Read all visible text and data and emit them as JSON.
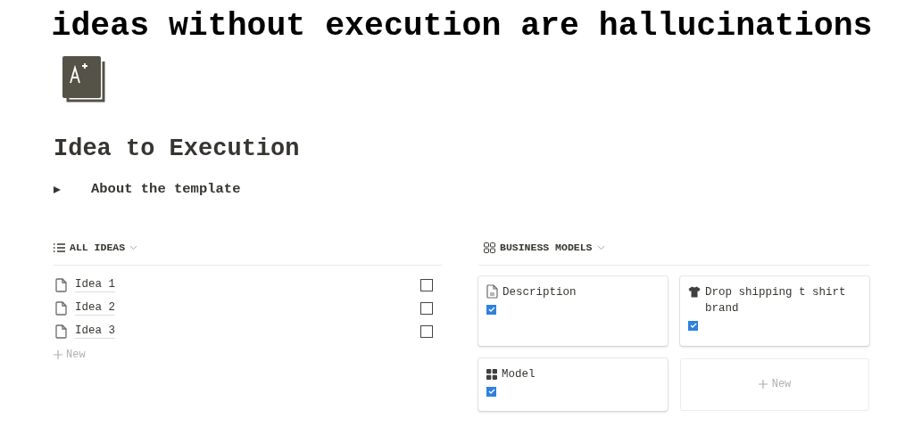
{
  "headline": "ideas without execution are hallucinations",
  "page": {
    "title": "Idea to Execution"
  },
  "toggle": {
    "label": "About the template",
    "expanded": false
  },
  "ideas": {
    "title": "ALL IDEAS",
    "rows": [
      {
        "name": "Idea 1",
        "checked": false
      },
      {
        "name": "Idea 2",
        "checked": false
      },
      {
        "name": "Idea 3",
        "checked": false
      }
    ],
    "new_label": "New"
  },
  "business_models": {
    "title": "BUSINESS MODELS",
    "cards": [
      {
        "kind": "doc",
        "name": "Description",
        "checked": true
      },
      {
        "kind": "shirt",
        "name": "Drop shipping t shirt brand",
        "checked": true
      },
      {
        "kind": "grid",
        "name": "Model",
        "checked": true
      }
    ],
    "new_label": "New"
  }
}
